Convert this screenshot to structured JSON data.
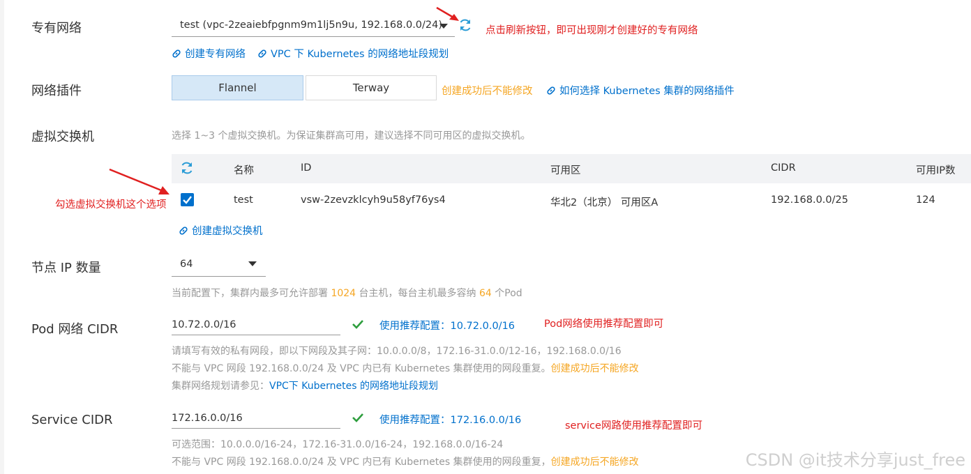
{
  "vpc": {
    "label": "专有网络",
    "selected": "test (vpc-2zeaiebfpgnm9m1lj5n9u, 192.168.0.0/24)",
    "annotation": "点击刷新按钮，即可出现刚才创建好的专有网络",
    "link_create": "创建专有网络",
    "link_plan": "VPC 下 Kubernetes 的网络地址段规划"
  },
  "plugin": {
    "label": "网络插件",
    "options": [
      "Flannel",
      "Terway"
    ],
    "selected": "Flannel",
    "warning": "创建成功后不能修改",
    "link_help": "如何选择 Kubernetes 集群的网络插件"
  },
  "vswitch": {
    "label": "虚拟交换机",
    "hint": "选择 1~3 个虚拟交换机。为保证集群高可用，建议选择不同可用区的虚拟交换机。",
    "columns": [
      "名称",
      "ID",
      "可用区",
      "CIDR",
      "可用IP数"
    ],
    "rows": [
      {
        "checked": true,
        "name": "test",
        "id": "vsw-2zevzklcyh9u58yf76ys4",
        "zone": "华北2（北京） 可用区A",
        "cidr": "192.168.0.0/25",
        "ips": "124"
      }
    ],
    "annotation": "勾选虚拟交换机这个选项",
    "link_create": "创建虚拟交换机"
  },
  "node_ip": {
    "label": "节点 IP 数量",
    "selected": "64",
    "hint_prefix": "当前配置下，集群内最多可允许部署",
    "hosts": "1024",
    "hint_mid": "台主机，每台主机最多容纳",
    "pods": "64",
    "hint_suffix": "个Pod"
  },
  "pod_cidr": {
    "label": "Pod 网络 CIDR",
    "value": "10.72.0.0/16",
    "recommend_label": "使用推荐配置：",
    "recommend_value": "10.72.0.0/16",
    "annotation": "Pod网络使用推荐配置即可",
    "hint1": "请填写有效的私有网段，即以下网段及其子网：10.0.0.0/8，172.16-31.0.0/12-16，192.168.0.0/16",
    "hint2": "不能与 VPC 网段 192.168.0.0/24 及 VPC 内已有 Kubernetes 集群使用的网段重复。",
    "hint2_warn": "创建成功后不能修改",
    "hint3": "集群网络规划请参见：",
    "hint3_link": "VPC下 Kubernetes 的网络地址段规划"
  },
  "service_cidr": {
    "label": "Service CIDR",
    "value": "172.16.0.0/16",
    "recommend_label": "使用推荐配置：",
    "recommend_value": "172.16.0.0/16",
    "annotation": "service网路使用推荐配置即可",
    "hint1": "可选范围：10.0.0.0/16-24，172.16-31.0.0/16-24，192.168.0.0/16-24",
    "hint2": "不能与 VPC 网段 192.168.0.0/24 及 VPC 内已有 Kubernetes 集群使用的网段重复，",
    "hint2_warn": "创建成功后不能修改"
  },
  "watermark": "CSDN @it技术分享just_free",
  "colors": {
    "link": "#0070cc",
    "annotation": "#e02020",
    "warning": "#f5a623",
    "success": "#2e9e3e",
    "active_segment": "#d6e8f7"
  },
  "icons": [
    "refresh-icon",
    "link-icon",
    "caret-down-icon",
    "checkbox-icon",
    "check-icon",
    "red-arrow-icon"
  ]
}
